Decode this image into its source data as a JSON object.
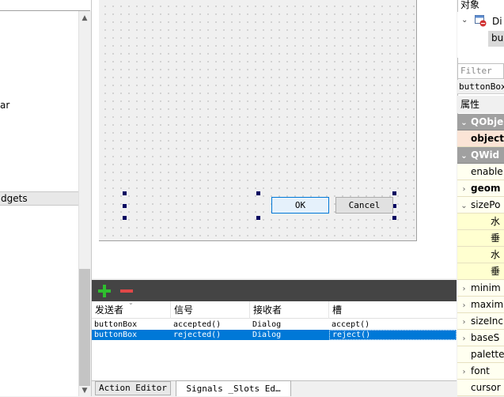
{
  "left_panel": {
    "partial_items": [
      "ar"
    ],
    "category_label": "dgets"
  },
  "form": {
    "ok_label": "OK",
    "cancel_label": "Cancel"
  },
  "signal_slot_editor": {
    "columns": [
      "发送者",
      "信号",
      "接收者",
      "槽"
    ],
    "rows": [
      {
        "sender": "buttonBox",
        "signal": "accepted()",
        "receiver": "Dialog",
        "slot": "accept()",
        "selected": false
      },
      {
        "sender": "buttonBox",
        "signal": "rejected()",
        "receiver": "Dialog",
        "slot": "reject()",
        "selected": true
      }
    ],
    "add_icon": "plus-icon",
    "remove_icon": "minus-icon",
    "colors": {
      "add": "#2fbf2f",
      "remove": "#e04848",
      "selection": "#0078d7"
    }
  },
  "tabs": {
    "action_editor": "Action Editor",
    "signals_slots": "Signals _Slots Ed…"
  },
  "object_inspector": {
    "title": "对象",
    "root_label": "Di",
    "child_label": "bu"
  },
  "property_editor": {
    "filter_placeholder": "Filter",
    "object_name": "buttonBox",
    "header": "属性",
    "rows": [
      {
        "label": "QObje",
        "kind": "group",
        "expander": "down"
      },
      {
        "label": "object",
        "kind": "red",
        "expander": ""
      },
      {
        "label": "QWid",
        "kind": "group",
        "expander": "down"
      },
      {
        "label": "enable",
        "kind": "yellow",
        "expander": ""
      },
      {
        "label": "geom",
        "kind": "yellow-bold",
        "expander": "right"
      },
      {
        "label": "sizePo",
        "kind": "yellow",
        "expander": "down"
      },
      {
        "label": "水",
        "kind": "yellow2-sub",
        "expander": ""
      },
      {
        "label": "垂",
        "kind": "yellow2-sub",
        "expander": ""
      },
      {
        "label": "水",
        "kind": "yellow2-sub",
        "expander": ""
      },
      {
        "label": "垂",
        "kind": "yellow2-sub",
        "expander": ""
      },
      {
        "label": "minim",
        "kind": "yellow",
        "expander": "right"
      },
      {
        "label": "maxim",
        "kind": "yellow",
        "expander": "right"
      },
      {
        "label": "sizeInc",
        "kind": "yellow",
        "expander": "right"
      },
      {
        "label": "baseS",
        "kind": "yellow",
        "expander": "right"
      },
      {
        "label": "palette",
        "kind": "yellow",
        "expander": ""
      },
      {
        "label": "font",
        "kind": "yellow",
        "expander": "right"
      },
      {
        "label": "cursor",
        "kind": "yellow",
        "expander": ""
      }
    ]
  }
}
